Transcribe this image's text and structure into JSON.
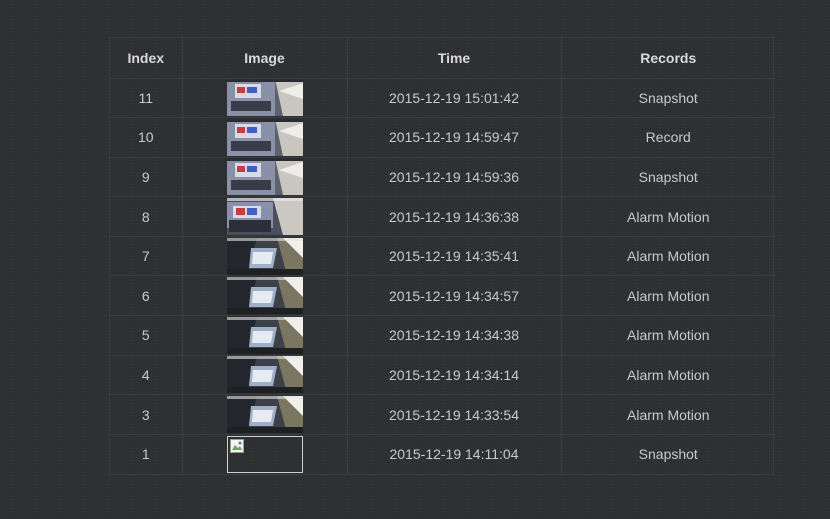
{
  "table": {
    "headers": {
      "index": "Index",
      "image": "Image",
      "time": "Time",
      "records": "Records"
    },
    "rows": [
      {
        "index": "11",
        "time": "2015-12-19 15:01:42",
        "record": "Snapshot",
        "thumb": "scene-a"
      },
      {
        "index": "10",
        "time": "2015-12-19 14:59:47",
        "record": "Record",
        "thumb": "scene-a"
      },
      {
        "index": "9",
        "time": "2015-12-19 14:59:36",
        "record": "Snapshot",
        "thumb": "scene-a"
      },
      {
        "index": "8",
        "time": "2015-12-19 14:36:38",
        "record": "Alarm Motion",
        "thumb": "scene-b"
      },
      {
        "index": "7",
        "time": "2015-12-19 14:35:41",
        "record": "Alarm Motion",
        "thumb": "scene-c"
      },
      {
        "index": "6",
        "time": "2015-12-19 14:34:57",
        "record": "Alarm Motion",
        "thumb": "scene-c"
      },
      {
        "index": "5",
        "time": "2015-12-19 14:34:38",
        "record": "Alarm Motion",
        "thumb": "scene-c"
      },
      {
        "index": "4",
        "time": "2015-12-19 14:34:14",
        "record": "Alarm Motion",
        "thumb": "scene-c"
      },
      {
        "index": "3",
        "time": "2015-12-19 14:33:54",
        "record": "Alarm Motion",
        "thumb": "scene-c"
      },
      {
        "index": "1",
        "time": "2015-12-19 14:11:04",
        "record": "Snapshot",
        "thumb": "broken-image"
      }
    ]
  }
}
